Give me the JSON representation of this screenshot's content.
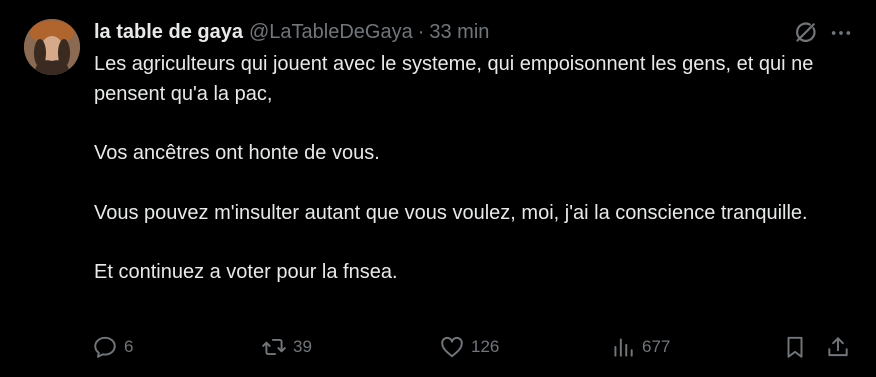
{
  "author": {
    "display_name": "la table de gaya",
    "handle": "@LaTableDeGaya",
    "separator": "·",
    "time": "33 min"
  },
  "top_icons": [
    "grok-icon",
    "more-icon"
  ],
  "body": {
    "paragraphs": [
      "Les agriculteurs qui jouent avec le systeme, qui empoisonnent les gens, et qui ne pensent qu'a la pac,",
      "Vos ancêtres ont honte de vous.",
      "Vous pouvez m'insulter autant que vous voulez, moi, j'ai la conscience tranquille.",
      "Et continuez a voter pour la fnsea."
    ]
  },
  "actions": {
    "replies": "6",
    "reposts": "39",
    "likes": "126",
    "views": "677"
  },
  "colors": {
    "background": "#000000",
    "text_primary": "#e7e9ea",
    "text_secondary": "#71767b"
  }
}
